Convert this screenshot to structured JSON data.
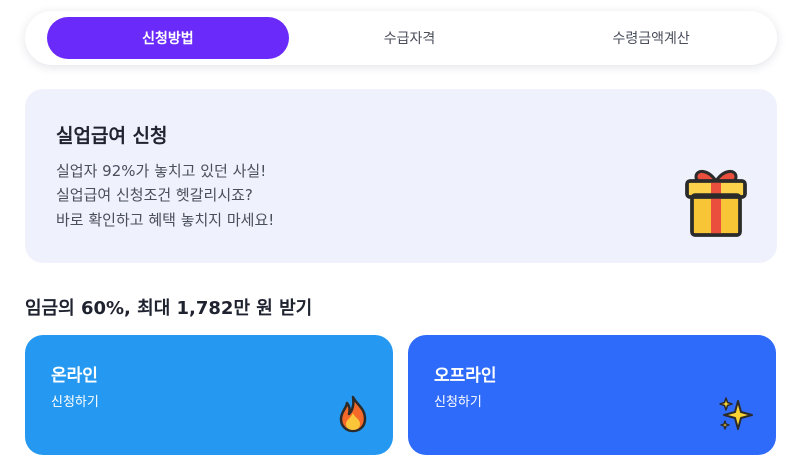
{
  "tabs": [
    {
      "label": "신청방법",
      "active": true
    },
    {
      "label": "수급자격",
      "active": false
    },
    {
      "label": "수령금액계산",
      "active": false
    }
  ],
  "hero": {
    "title": "실업급여 신청",
    "lines": [
      "실업자 92%가 놓치고 있던 사실!",
      "실업급여 신청조건 헷갈리시죠?",
      "바로 확인하고 혜택 놓치지 마세요!"
    ],
    "icon": "gift-icon"
  },
  "section": {
    "title": "임금의 60%, 최대 1,782만 원 받기"
  },
  "cards": [
    {
      "title": "온라인",
      "subtitle": "신청하기",
      "icon": "fire-icon",
      "color": "#2599f2"
    },
    {
      "title": "오프라인",
      "subtitle": "신청하기",
      "icon": "sparkles-icon",
      "color": "#2f6bfb"
    }
  ],
  "colors": {
    "accent": "#6a2bfa",
    "hero_bg": "#eff1fd"
  }
}
